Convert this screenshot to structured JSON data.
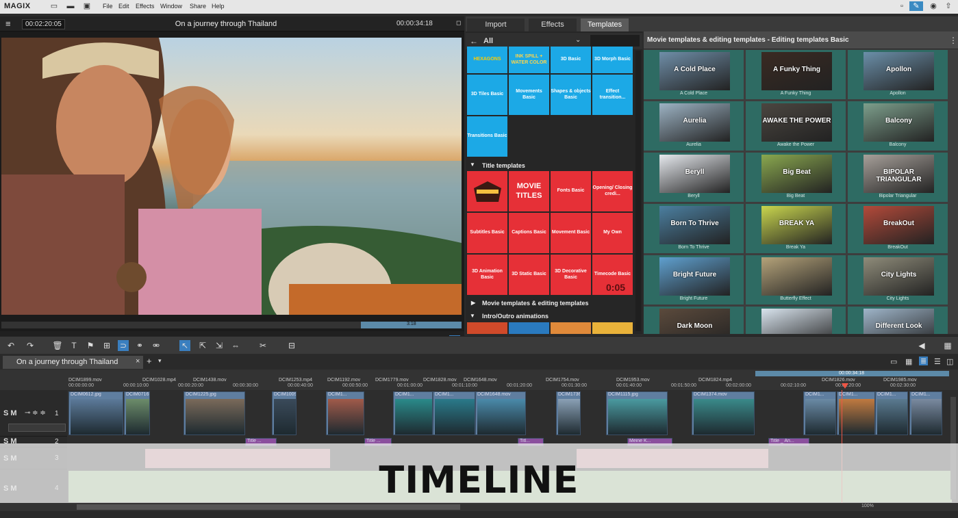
{
  "app": {
    "logo": "MAGIX"
  },
  "menu": [
    "File",
    "Edit",
    "Effects",
    "Window",
    "Share",
    "Help"
  ],
  "player": {
    "timecode_current": "00:02:20:05",
    "title": "On a journey through Thailand",
    "timecode_total": "00:00:34:18",
    "scrub_marker": "3:18"
  },
  "panel_tabs": [
    "Import",
    "Effects",
    "Templates"
  ],
  "templates": {
    "filter": "All",
    "top_row": [
      {
        "label": "HEXAGONS",
        "color": "blue"
      },
      {
        "label": "INK SPILL + WATER COLOR",
        "color": "blue"
      },
      {
        "label": "3D Basic",
        "color": "blue"
      },
      {
        "label": "3D Morph Basic",
        "color": "blue"
      }
    ],
    "row2": [
      "3D Tiles Basic",
      "Movements Basic",
      "Shapes & objects Basic",
      "Effect transition..."
    ],
    "row3": [
      "Transitions Basic"
    ],
    "section_title": "Title templates",
    "title_rows": [
      [
        "",
        "MOVIE TITLES",
        "Fonts Basic",
        "Opening/ Closing credi..."
      ],
      [
        "Subtitles Basic",
        "Captions Basic",
        "Movement Basic",
        "My Own"
      ],
      [
        "3D Animation Basic",
        "3D Static Basic",
        "3D Decorative Basic",
        "Timecode Basic"
      ]
    ],
    "timecode_tile_text": "0:05",
    "section_movie": "Movie templates & editing templates",
    "section_intro": "Intro/Outro animations"
  },
  "right_panel": {
    "title": "Movie templates & editing templates - Editing templates Basic",
    "items": [
      {
        "label": "A Cold Place",
        "overlay": "A Cold Place",
        "bg": "#6f8ea8"
      },
      {
        "label": "A Funky Thing",
        "overlay": "A Funky Thing",
        "bg": "#3a2a22"
      },
      {
        "label": "Apollon",
        "overlay": "Apollon",
        "bg": "#6b8fa9"
      },
      {
        "label": "Aurelia",
        "overlay": "Aurelia",
        "bg": "#9db3c4"
      },
      {
        "label": "Awake the Power",
        "overlay": "AWAKE THE POWER",
        "bg": "#4b4640"
      },
      {
        "label": "Balcony",
        "overlay": "Balcony",
        "bg": "#7d9f8c"
      },
      {
        "label": "Beryll",
        "overlay": "Beryll",
        "bg": "#e6e9ee"
      },
      {
        "label": "Big Beat",
        "overlay": "Big Beat",
        "bg": "#8aa84f"
      },
      {
        "label": "Bipolar Triangular",
        "overlay": "BIPOLAR TRIANGULAR",
        "bg": "#a7a09a"
      },
      {
        "label": "Born To Thrive",
        "overlay": "Born To Thrive",
        "bg": "#4b7fa0"
      },
      {
        "label": "Break Ya",
        "overlay": "BREAK YA",
        "bg": "#c9d64e"
      },
      {
        "label": "BreakOut",
        "overlay": "BreakOut",
        "bg": "#b34a3a"
      },
      {
        "label": "Bright Future",
        "overlay": "Bright Future",
        "bg": "#5fa0cf"
      },
      {
        "label": "Butterfly Effect",
        "overlay": "",
        "bg": "#b5a37a"
      },
      {
        "label": "City Lights",
        "overlay": "City Lights",
        "bg": "#8f8c7a"
      },
      {
        "label": "",
        "overlay": "Dark Moon",
        "bg": "#5b4a3c"
      },
      {
        "label": "",
        "overlay": "",
        "bg": "#d9e4ee"
      },
      {
        "label": "",
        "overlay": "Different Look",
        "bg": "#9fb5c9"
      }
    ]
  },
  "timeline": {
    "arrangement_tab": "On a journey through Thailand",
    "ruler_marker": "00:00:34:18",
    "ruler_times": [
      "00:00:00:00",
      "00:00:10:00",
      "00:00:20:00",
      "00:00:30:00",
      "00:00:40:00",
      "00:00:50:00",
      "00:01:00:00",
      "00:01:10:00",
      "00:01:20:00",
      "00:01:30:00",
      "00:01:40:00",
      "00:01:50:00",
      "00:02:00:00",
      "00:02:10:00",
      "00:02:20:00",
      "00:02:30:00"
    ],
    "ruler_clips": [
      "DCIM1899.mov",
      "DCIM1028.mp4",
      "DCIM1438.mov",
      "DCIM1253.mp4",
      "DCIM1192.mov",
      "DCIM1779.mov",
      "DCIM1828.mov",
      "DCIM1648.mov",
      "DCIM1754.mov",
      "DCIM1953.mov",
      "DCIM1824.mp4",
      "DCIM1826.mov",
      "DCIM1985.mov"
    ],
    "track_numbers": [
      "1",
      "2",
      "3",
      "4"
    ],
    "track_controls": "S M",
    "video_clips": [
      {
        "label": "DCIM0612.jpg"
      },
      {
        "label": "DCIM0716.jpg"
      },
      {
        "label": "DCIM1225.jpg"
      },
      {
        "label": "DCIM1009.jpg"
      },
      {
        "label": "DCIM1..."
      },
      {
        "label": "DCIM1..."
      },
      {
        "label": "DCIM1..."
      },
      {
        "label": "DCIM1648.mov"
      },
      {
        "label": "DCIM1736.jpg"
      },
      {
        "label": "DCIM1115.jpg"
      },
      {
        "label": "DCIM1374.mov"
      },
      {
        "label": "DCIM1..."
      },
      {
        "label": "DCIM1..."
      },
      {
        "label": "DCIM1..."
      },
      {
        "label": "DCIM1..."
      }
    ],
    "title_clips": [
      "Title ...",
      "Title ...",
      "Titl...",
      "Meine K...",
      "Title _ An..."
    ],
    "overlay_label": "TIMELINE",
    "zoom": "100%"
  }
}
